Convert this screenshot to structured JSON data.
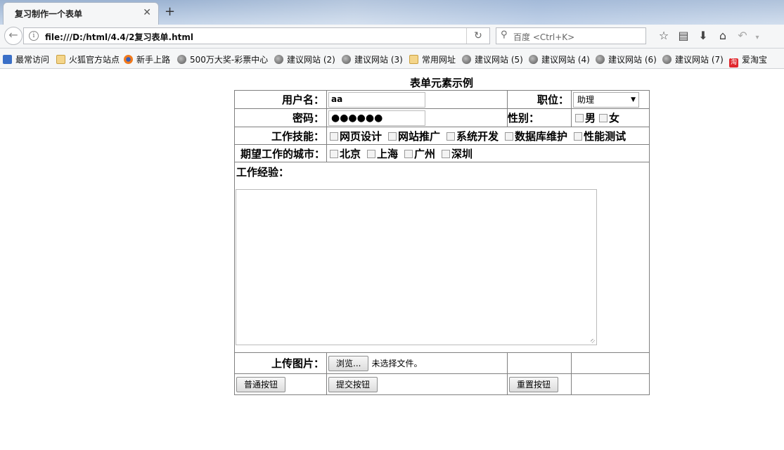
{
  "browser": {
    "tab_title": "复习制作一个表单",
    "new_tab": "+",
    "url": "file:///D:/html/4.4/2复习表单.html",
    "search_placeholder": "百度 <Ctrl+K>",
    "bookmarks": [
      {
        "label": "最常访问",
        "icon": "pin-icon"
      },
      {
        "label": "火狐官方站点",
        "icon": "folder-icon"
      },
      {
        "label": "新手上路",
        "icon": "firefox-icon"
      },
      {
        "label": "500万大奖-彩票中心",
        "icon": "globe-icon"
      },
      {
        "label": "建议网站 (2)",
        "icon": "globe-icon"
      },
      {
        "label": "建议网站 (3)",
        "icon": "globe-icon"
      },
      {
        "label": "常用网址",
        "icon": "folder-icon"
      },
      {
        "label": "建议网站 (5)",
        "icon": "globe-icon"
      },
      {
        "label": "建议网站 (4)",
        "icon": "globe-icon"
      },
      {
        "label": "建议网站 (6)",
        "icon": "globe-icon"
      },
      {
        "label": "建议网站 (7)",
        "icon": "globe-icon"
      },
      {
        "label": "爱淘宝",
        "icon": "taobao-icon"
      }
    ]
  },
  "form": {
    "title": "表单元素示例",
    "username_label": "用户名：",
    "username_value": "aa",
    "position_label": "职位：",
    "position_selected": "助理",
    "password_label": "密码：",
    "password_value": "●●●●●●",
    "gender_label": "性别：",
    "gender_options": [
      "男",
      "女"
    ],
    "skills_label": "工作技能：",
    "skills": [
      "网页设计",
      "网站推广",
      "系统开发",
      "数据库维护",
      "性能测试"
    ],
    "cities_label": "期望工作的城市：",
    "cities": [
      "北京",
      "上海",
      "广州",
      "深圳"
    ],
    "experience_label": "工作经验：",
    "upload_label": "上传图片：",
    "browse_button": "浏览...",
    "no_file": "未选择文件。",
    "normal_button": "普通按钮",
    "submit_button": "提交按钮",
    "reset_button": "重置按钮"
  }
}
